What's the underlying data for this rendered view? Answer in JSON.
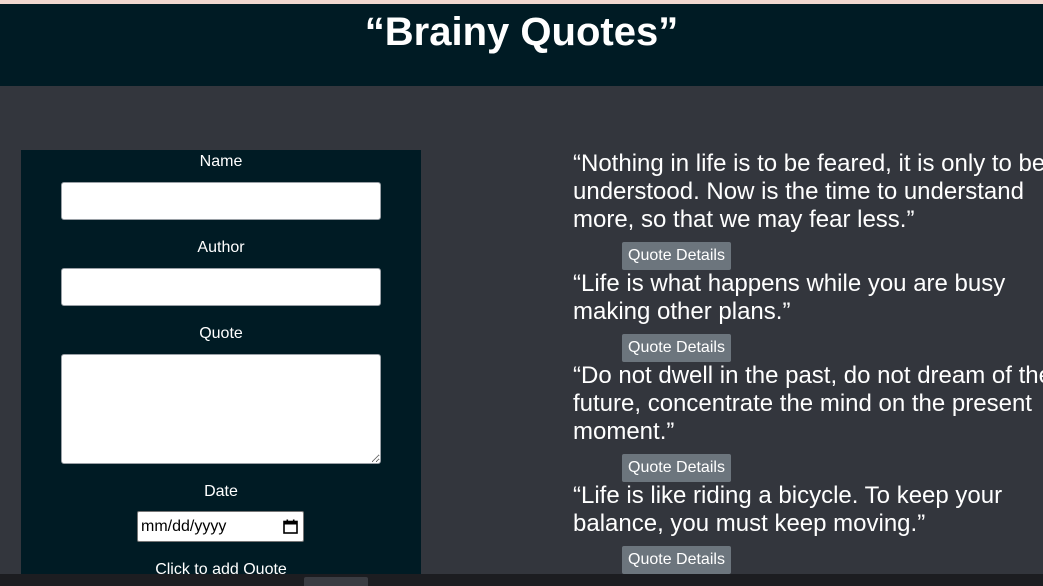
{
  "header": {
    "title": "“Brainy Quotes”"
  },
  "form": {
    "name_label": "Name",
    "author_label": "Author",
    "quote_label": "Quote",
    "date_label": "Date",
    "date_placeholder": "mm/dd/yyyy",
    "submit_label": "Click to add Quote"
  },
  "quotes": [
    {
      "text": "“Nothing in life is to be feared, it is only to be understood. Now is the time to understand more, so that we may fear less.”",
      "button_label": "Quote Details"
    },
    {
      "text": "“Life is what happens while you are busy making other plans.”",
      "button_label": "Quote Details"
    },
    {
      "text": "“Do not dwell in the past, do not dream of the future, concentrate the mind on the present moment.”",
      "button_label": "Quote Details"
    },
    {
      "text": "“Life is like riding a bicycle. To keep your balance, you must keep moving.”",
      "button_label": "Quote Details"
    }
  ],
  "colors": {
    "header_bg": "#001b24",
    "page_bg": "#33363d",
    "button_bg": "#6c757d"
  }
}
